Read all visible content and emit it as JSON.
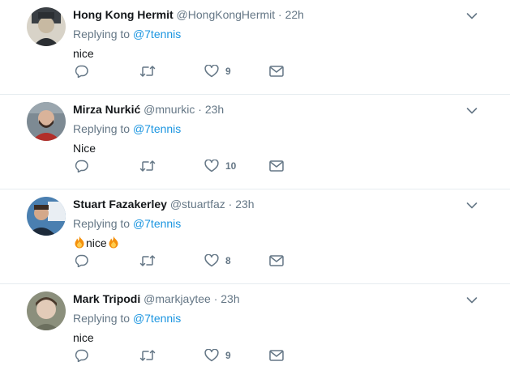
{
  "replies": [
    {
      "name": "Hong Kong Hermit",
      "handle": "@HongKongHermit",
      "dot": "·",
      "time": "22h",
      "replying_prefix": "Replying to ",
      "replying_to": "@7tennis",
      "text": "nice",
      "likes": "9",
      "avatar_colors": [
        "#2b2f33",
        "#c7b9a2"
      ]
    },
    {
      "name": "Mirza Nurkić",
      "handle": "@mnurkic",
      "dot": "·",
      "time": "23h",
      "replying_prefix": "Replying to ",
      "replying_to": "@7tennis",
      "text": "Nice",
      "likes": "10",
      "avatar_colors": [
        "#b22f2a",
        "#7d8a93"
      ]
    },
    {
      "name": "Stuart Fazakerley",
      "handle": "@stuartfaz",
      "dot": "·",
      "time": "23h",
      "replying_prefix": "Replying to ",
      "replying_to": "@7tennis",
      "text": "nice",
      "text_has_flames": true,
      "likes": "8",
      "avatar_colors": [
        "#1d2a3a",
        "#4a7fb0"
      ]
    },
    {
      "name": "Mark Tripodi",
      "handle": "@markjaytee",
      "dot": "·",
      "time": "23h",
      "replying_prefix": "Replying to ",
      "replying_to": "@7tennis",
      "text": "nice",
      "likes": "9",
      "avatar_colors": [
        "#6b6f5e",
        "#e2cbb8"
      ]
    }
  ],
  "icons": {
    "reply": "reply-icon",
    "retweet": "retweet-icon",
    "like": "heart-icon",
    "dm": "envelope-icon",
    "menu": "chevron-down-icon"
  },
  "colors": {
    "link": "#1b95e0",
    "muted": "#657786",
    "text": "#14171a",
    "divider": "#e6ecf0"
  }
}
